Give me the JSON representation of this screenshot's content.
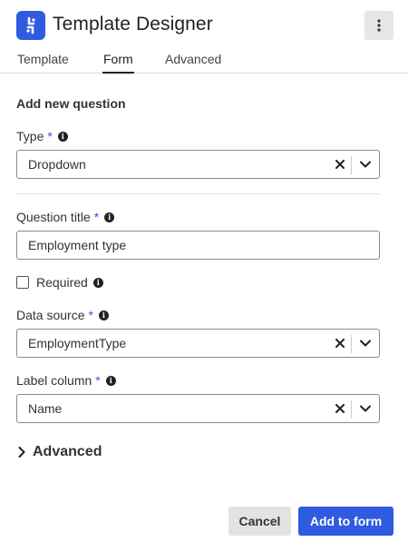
{
  "app": {
    "title": "Template Designer",
    "brand_color": "#2f5be0"
  },
  "icons": {
    "logo": "app-logo-icon",
    "menu": "kebab-menu-icon",
    "clear": "close-icon",
    "dropdown": "chevron-down-icon",
    "info": "info-icon",
    "expand": "chevron-right-icon"
  },
  "tabs": [
    {
      "label": "Template",
      "active": false
    },
    {
      "label": "Form",
      "active": true
    },
    {
      "label": "Advanced",
      "active": false
    }
  ],
  "form": {
    "section_title": "Add new question",
    "required_marker": "*",
    "type": {
      "label": "Type",
      "value": "Dropdown"
    },
    "question_title": {
      "label": "Question title",
      "value": "Employment type"
    },
    "required": {
      "label": "Required",
      "checked": false
    },
    "data_source": {
      "label": "Data source",
      "value": "EmploymentType"
    },
    "label_column": {
      "label": "Label column",
      "value": "Name"
    },
    "advanced": {
      "label": "Advanced"
    }
  },
  "buttons": {
    "cancel": "Cancel",
    "add": "Add to form"
  }
}
